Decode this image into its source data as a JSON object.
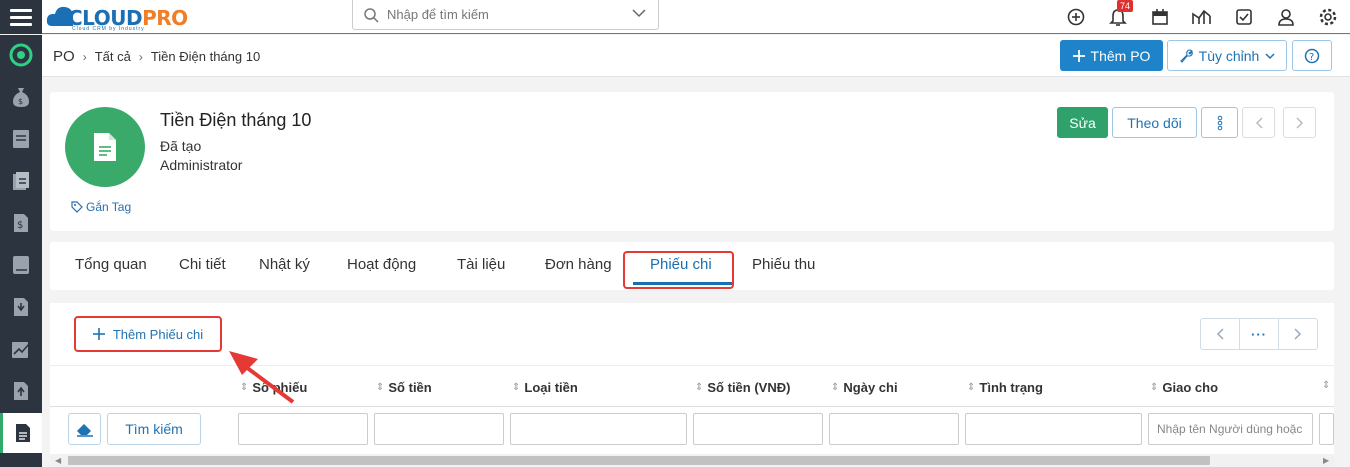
{
  "app": {
    "logo_text_a": "CLOUD",
    "logo_text_b": "PRO",
    "logo_sub": "Cloud CRM by Industry",
    "search_placeholder": "Nhập để tìm kiếm",
    "notification_count": "74",
    "icons": [
      "plus-circle-icon",
      "bell-icon",
      "calendar-icon",
      "chart-icon",
      "checkbox-icon",
      "user-icon",
      "gear-icon"
    ]
  },
  "breadcrumb": {
    "root": "PO",
    "level1": "Tất cả",
    "level2": "Tiền Điện tháng 10"
  },
  "header_actions": {
    "add_label": "Thêm PO",
    "customize_label": "Tùy chỉnh"
  },
  "record": {
    "title": "Tiền Điện tháng 10",
    "status": "Đã tạo",
    "owner": "Administrator",
    "tag_label": "Gắn Tag",
    "edit_label": "Sửa",
    "follow_label": "Theo dõi"
  },
  "tabs": [
    {
      "label": "Tổng quan"
    },
    {
      "label": "Chi tiết"
    },
    {
      "label": "Nhật ký"
    },
    {
      "label": "Hoạt động"
    },
    {
      "label": "Tài liệu"
    },
    {
      "label": "Đơn hàng"
    },
    {
      "label": "Phiếu chi"
    },
    {
      "label": "Phiếu thu"
    }
  ],
  "active_tab": "Phiếu chi",
  "panel": {
    "add_label": "Thêm Phiếu chi",
    "pager_more": "···",
    "columns": [
      {
        "label": "Số phiếu"
      },
      {
        "label": "Số tiền"
      },
      {
        "label": "Loại tiền"
      },
      {
        "label": "Số tiền (VNĐ)"
      },
      {
        "label": "Ngày chi"
      },
      {
        "label": "Tình trạng"
      },
      {
        "label": "Giao cho"
      }
    ],
    "search_button": "Tìm kiếm",
    "assignee_placeholder": "Nhập tên Người dùng hoặc"
  },
  "colors": {
    "accent_blue": "#1e83c9",
    "green": "#2fa26c",
    "highlight_red": "#e53935",
    "nav_bg": "#2c3440"
  }
}
